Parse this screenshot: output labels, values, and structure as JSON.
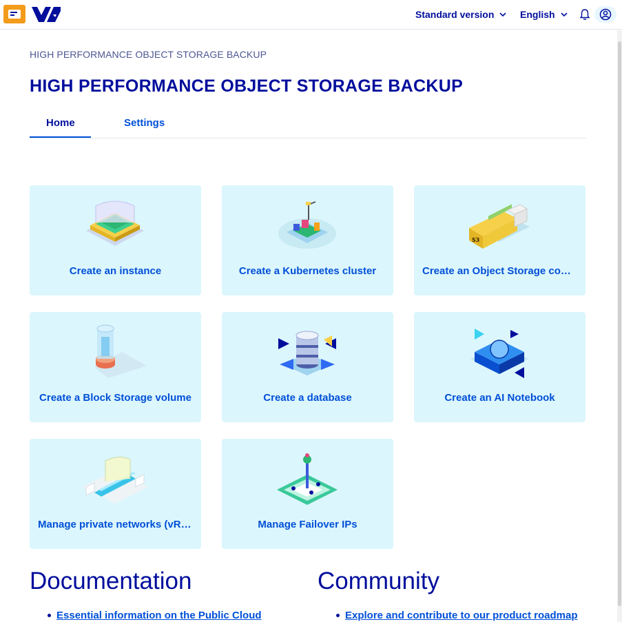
{
  "header": {
    "menu_icon": "menu-icon",
    "logo_icon": "ovh-logo-icon",
    "version_label": "Standard version",
    "language_label": "English",
    "notification_icon": "bell-icon",
    "account_icon": "user-icon"
  },
  "breadcrumb": "HIGH PERFORMANCE OBJECT STORAGE BACKUP",
  "page_title": "HIGH PERFORMANCE OBJECT STORAGE BACKUP",
  "tabs": [
    {
      "label": "Home",
      "active": true
    },
    {
      "label": "Settings",
      "active": false
    }
  ],
  "cards": [
    {
      "label": "Create an instance",
      "icon": "instance-icon"
    },
    {
      "label": "Create a Kubernetes cluster",
      "icon": "kubernetes-icon"
    },
    {
      "label": "Create an Object Storage container",
      "icon": "object-storage-icon"
    },
    {
      "label": "Create a Block Storage volume",
      "icon": "block-storage-icon"
    },
    {
      "label": "Create a database",
      "icon": "database-icon"
    },
    {
      "label": "Create an AI Notebook",
      "icon": "ai-notebook-icon"
    },
    {
      "label": "Manage private networks (vRack)",
      "icon": "private-network-icon"
    },
    {
      "label": "Manage Failover IPs",
      "icon": "failover-ip-icon"
    }
  ],
  "documentation": {
    "title": "Documentation",
    "links": [
      "Essential information on the Public Cloud"
    ]
  },
  "community": {
    "title": "Community",
    "links": [
      "Explore and contribute to our product roadmap"
    ]
  },
  "colors": {
    "primary": "#000e9c",
    "link": "#0050d7",
    "card_bg": "#dcf6fd",
    "accent": "#f39b1b"
  }
}
